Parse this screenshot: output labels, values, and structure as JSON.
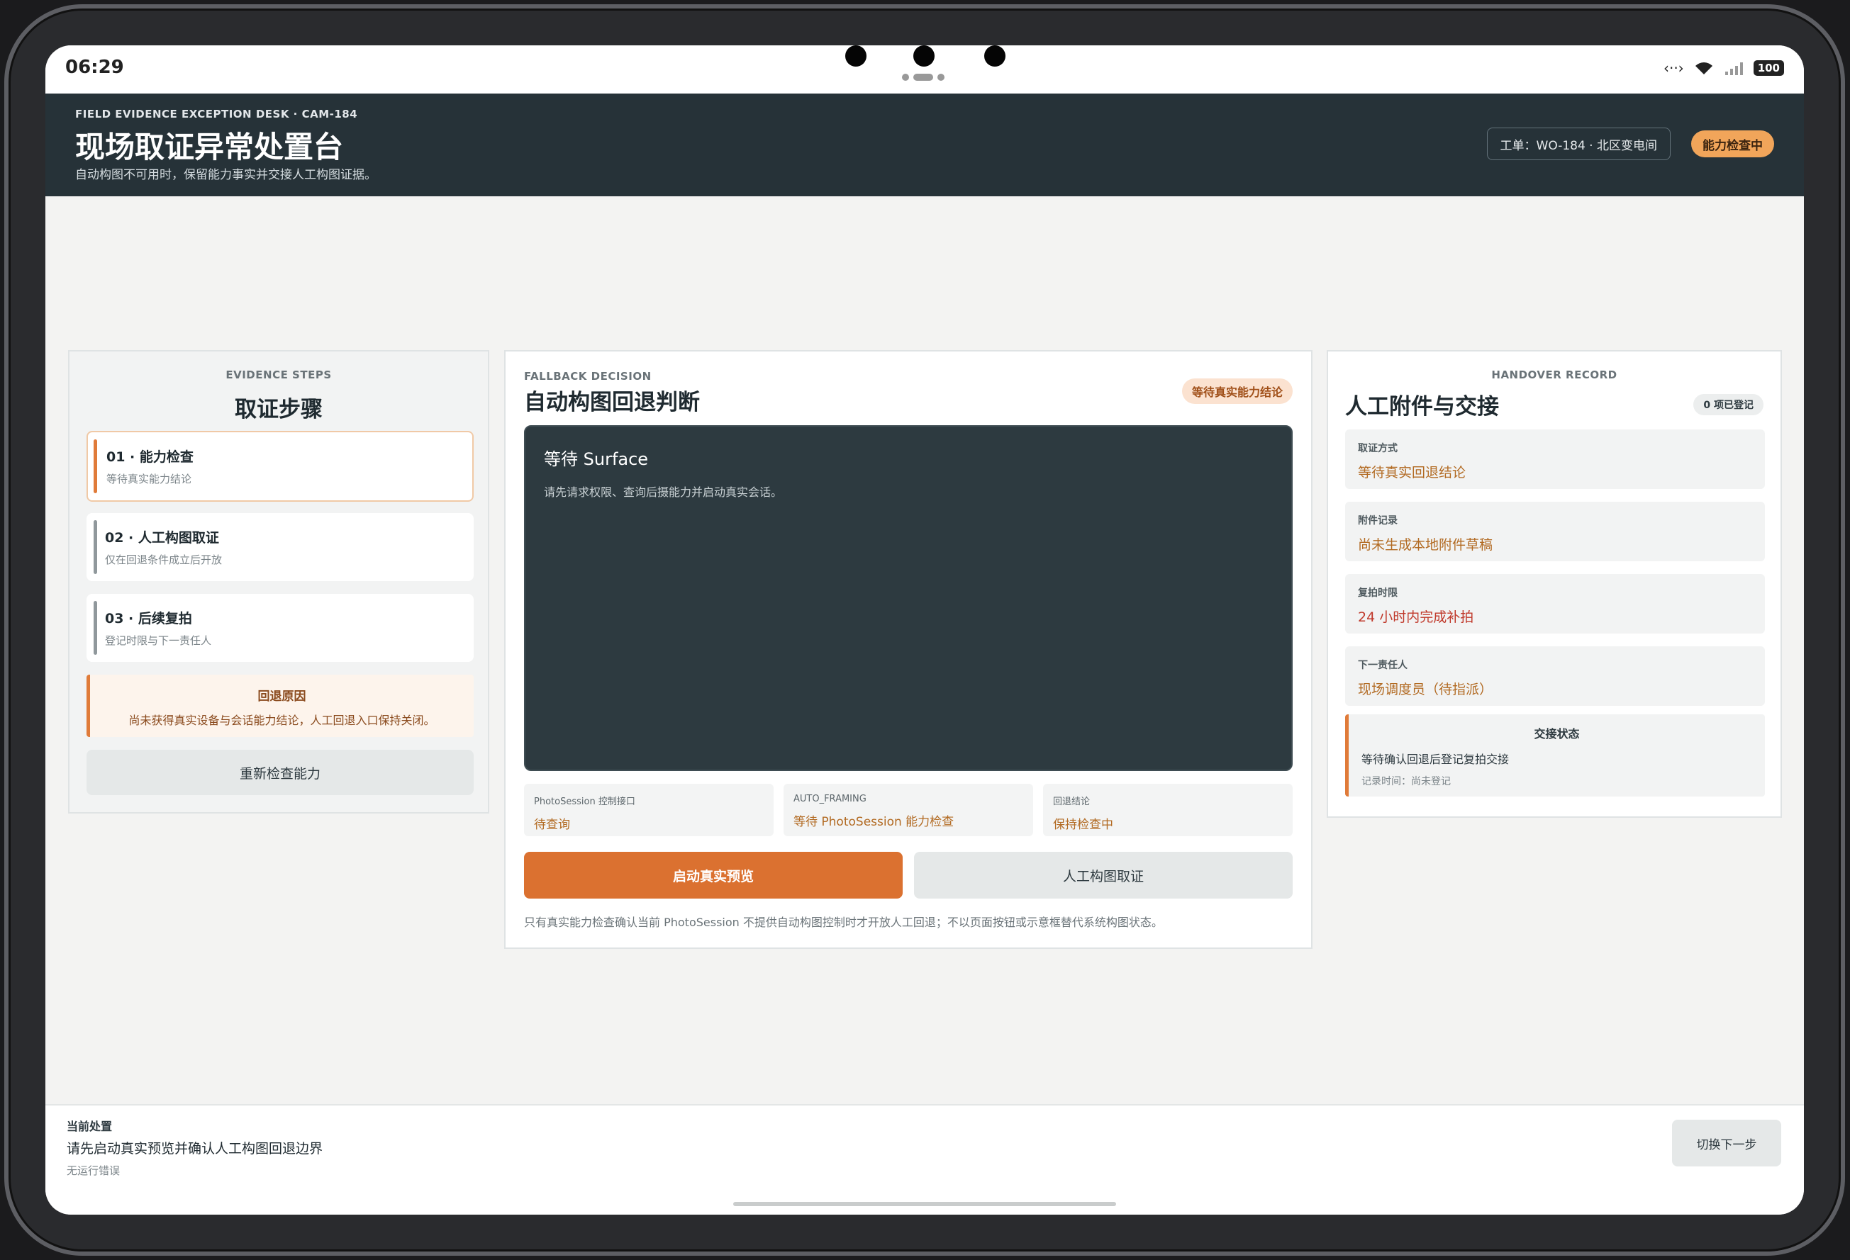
{
  "status_bar": {
    "time": "06:29",
    "battery": "100"
  },
  "header": {
    "eyebrow": "FIELD EVIDENCE EXCEPTION DESK · CAM-184",
    "title": "现场取证异常处置台",
    "subtitle": "自动构图不可用时，保留能力事实并交接人工构图证据。",
    "work_order": "工单：WO-184 · 北区变电间",
    "status_badge": "能力检查中"
  },
  "steps_panel": {
    "eyebrow": "EVIDENCE STEPS",
    "title": "取证步骤",
    "steps": [
      {
        "title": "01 · 能力检查",
        "sub": "等待真实能力结论"
      },
      {
        "title": "02 · 人工构图取证",
        "sub": "仅在回退条件成立后开放"
      },
      {
        "title": "03 · 后续复拍",
        "sub": "登记时限与下一责任人"
      }
    ],
    "reason_title": "回退原因",
    "reason_text": "尚未获得真实设备与会话能力结论，人工回退入口保持关闭。",
    "recheck_button": "重新检查能力"
  },
  "decision_panel": {
    "eyebrow": "FALLBACK DECISION",
    "title": "自动构图回退判断",
    "badge": "等待真实能力结论",
    "surface_title": "等待 Surface",
    "surface_text": "请先请求权限、查询后摄能力并启动真实会话。",
    "facts": [
      {
        "label": "PhotoSession 控制接口",
        "value": "待查询"
      },
      {
        "label": "AUTO_FRAMING",
        "value": "等待 PhotoSession 能力检查"
      },
      {
        "label": "回退结论",
        "value": "保持检查中"
      }
    ],
    "start_button": "启动真实预览",
    "manual_button": "人工构图取证",
    "note": "只有真实能力检查确认当前 PhotoSession 不提供自动构图控制时才开放人工回退；不以页面按钮或示意框替代系统构图状态。"
  },
  "handover_panel": {
    "eyebrow": "HANDOVER RECORD",
    "title": "人工附件与交接",
    "count_badge": "0 项已登记",
    "fields": [
      {
        "label": "取证方式",
        "value": "等待真实回退结论"
      },
      {
        "label": "附件记录",
        "value": "尚未生成本地附件草稿"
      },
      {
        "label": "复拍时限",
        "value": "24 小时内完成补拍"
      },
      {
        "label": "下一责任人",
        "value": "现场调度员（待指派）"
      }
    ],
    "handover_title": "交接状态",
    "handover_text": "等待确认回退后登记复拍交接",
    "record_time": "记录时间：尚未登记"
  },
  "bottom_bar": {
    "label": "当前处置",
    "action": "请先启动真实预览并确认人工构图回退边界",
    "error": "无运行错误",
    "next_button": "切换下一步"
  },
  "colors": {
    "header_bg": "#263238",
    "accent": "#db7130",
    "badge": "#f1a55a"
  }
}
